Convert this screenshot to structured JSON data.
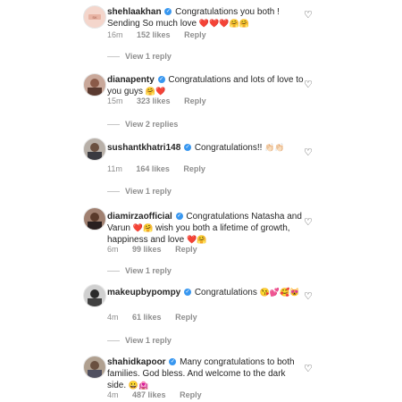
{
  "comments": [
    {
      "username": "shehlaakhan",
      "text": "Congratulations you both ! Sending So much love",
      "emoji": "❤️❤️❤️🤗🤗",
      "time": "16m",
      "likes": "152 likes",
      "reply": "Reply",
      "view_replies": "View 1 reply"
    },
    {
      "username": "dianapenty",
      "text": "Congratulations and lots of love to you guys",
      "emoji": "🤗❤️",
      "time": "15m",
      "likes": "323 likes",
      "reply": "Reply",
      "view_replies": "View 2 replies"
    },
    {
      "username": "sushantkhatri148",
      "text": "Congratulations!!",
      "emoji": "👏🏻👏🏻",
      "time": "11m",
      "likes": "164 likes",
      "reply": "Reply",
      "view_replies": "View 1 reply"
    },
    {
      "username": "diamirzaofficial",
      "text": "Congratulations Natasha and Varun",
      "emoji": "❤️🤗",
      "text2": "wish you both a lifetime of growth, happiness and love",
      "emoji2": "❤️🤗",
      "time": "6m",
      "likes": "99 likes",
      "reply": "Reply",
      "view_replies": "View 1 reply"
    },
    {
      "username": "makeupbypompy",
      "text": "Congratulations",
      "emoji": "😘💕🥰😻",
      "time": "4m",
      "likes": "61 likes",
      "reply": "Reply",
      "view_replies": "View 1 reply"
    },
    {
      "username": "shahidkapoor",
      "text": "Many congratulations to both families. God bless. And welcome to the dark side.",
      "emoji": "😀🏩",
      "time": "4m",
      "likes": "487 likes",
      "reply": "Reply"
    }
  ],
  "colors": {
    "verified": "#3897f0",
    "meta": "#8e8e8e",
    "text": "#262626"
  }
}
